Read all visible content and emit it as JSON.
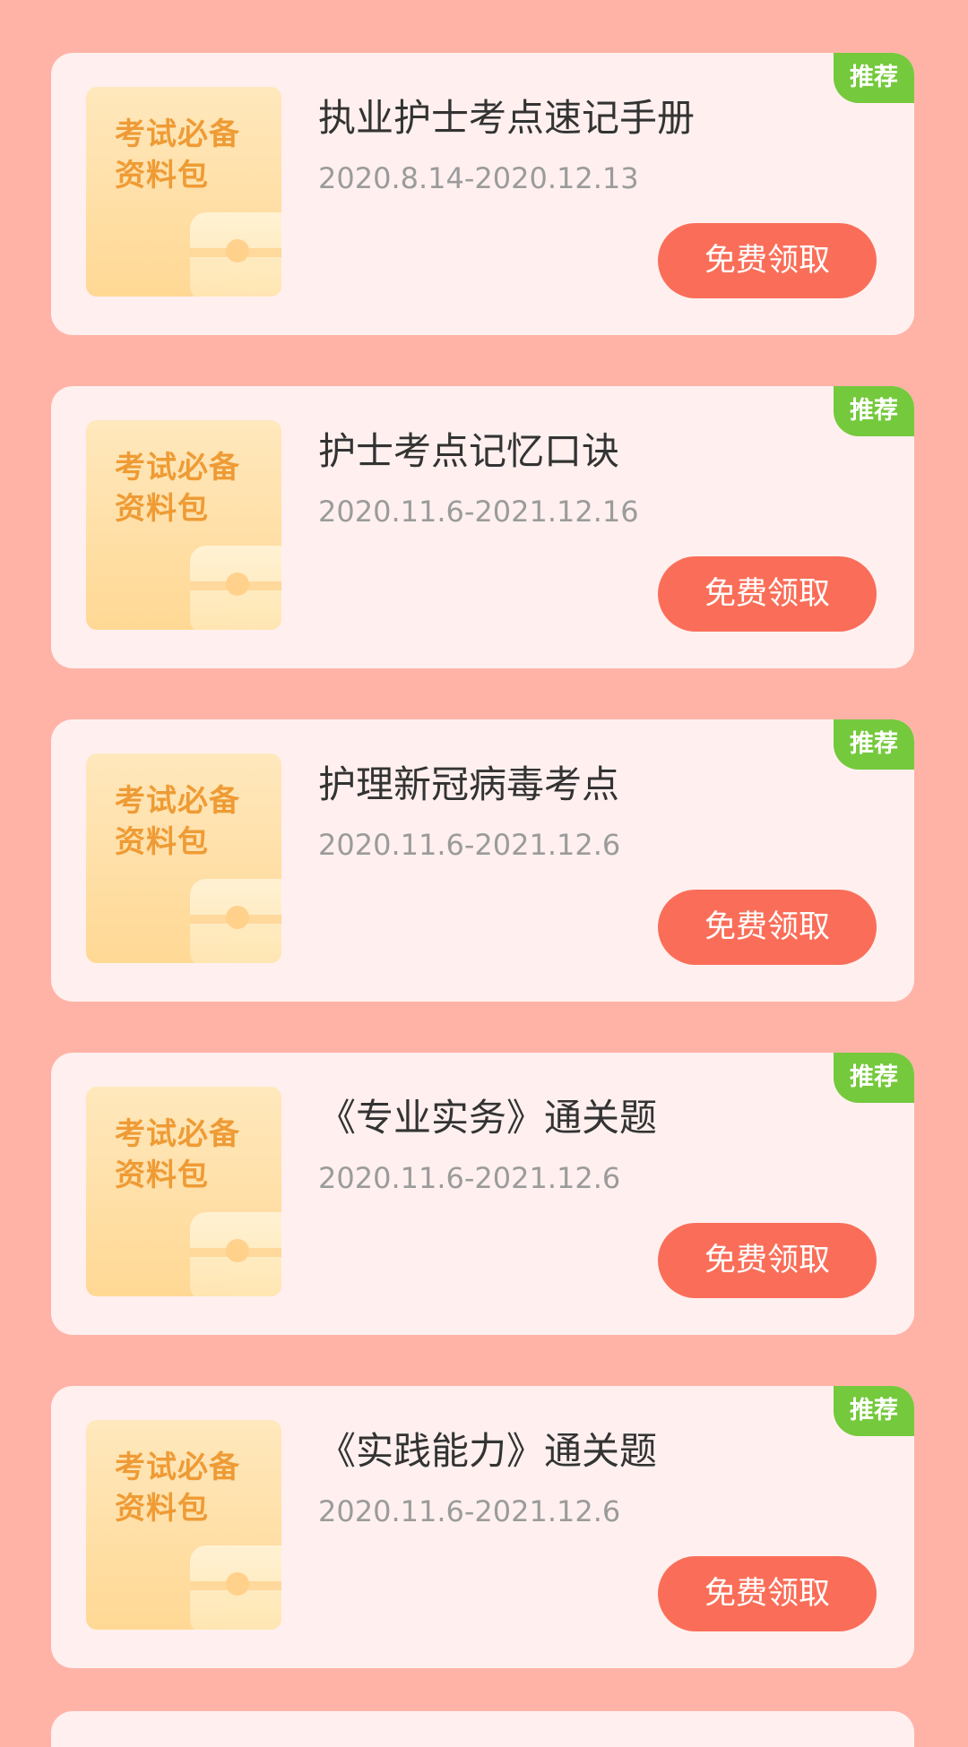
{
  "cards": [
    {
      "badge": "推荐",
      "thumb_line1": "考试必备",
      "thumb_line2": "资料包",
      "title": "执业护士考点速记手册",
      "date": "2020.8.14-2020.12.13",
      "button": "免费领取"
    },
    {
      "badge": "推荐",
      "thumb_line1": "考试必备",
      "thumb_line2": "资料包",
      "title": "护士考点记忆口诀",
      "date": "2020.11.6-2021.12.16",
      "button": "免费领取"
    },
    {
      "badge": "推荐",
      "thumb_line1": "考试必备",
      "thumb_line2": "资料包",
      "title": "护理新冠病毒考点",
      "date": "2020.11.6-2021.12.6",
      "button": "免费领取"
    },
    {
      "badge": "推荐",
      "thumb_line1": "考试必备",
      "thumb_line2": "资料包",
      "title": "《专业实务》通关题",
      "date": "2020.11.6-2021.12.6",
      "button": "免费领取"
    },
    {
      "badge": "推荐",
      "thumb_line1": "考试必备",
      "thumb_line2": "资料包",
      "title": "《实践能力》通关题",
      "date": "2020.11.6-2021.12.6",
      "button": "免费领取"
    }
  ],
  "colors": {
    "background": "#ffb3a7",
    "card": "#fff0ef",
    "badge": "#75c93c",
    "button": "#fa6e59",
    "thumb_text": "#ef9b35"
  },
  "icons": {
    "bag": "bag-icon"
  }
}
